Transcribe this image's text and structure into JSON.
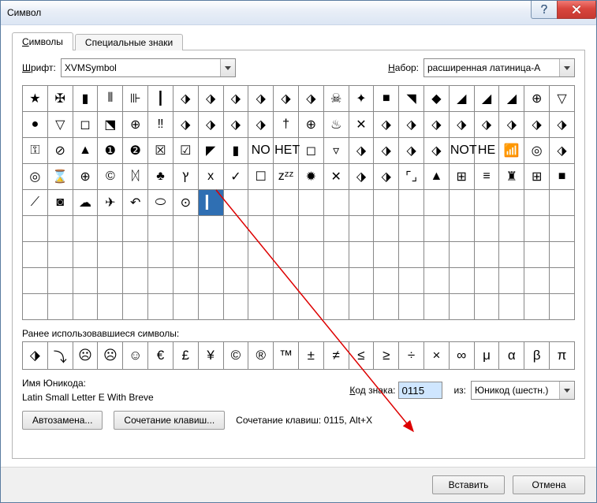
{
  "window": {
    "title": "Символ"
  },
  "tabs": {
    "symbols": "Символы",
    "special": "Специальные знаки"
  },
  "font_row": {
    "label": "Шрифт:",
    "value": "XVMSymbol",
    "set_label": "Набор:",
    "set_value": "расширенная латиница-A"
  },
  "grid": {
    "cols": 22,
    "rows": 9,
    "items": [
      "★",
      "✠",
      "▮",
      "⦀",
      "⊪",
      "┃",
      "⬗",
      "⬗",
      "⬗",
      "⬗",
      "⬗",
      "⬗",
      "☠",
      "✦",
      "■",
      "◥",
      "◆",
      "◢",
      "◢",
      "◢",
      "⊕",
      "▽",
      "●",
      "▽",
      "◻",
      "⬔",
      "⊕",
      "‼",
      "⬗",
      "⬗",
      "⬗",
      "⬗",
      "†",
      "⊕",
      "♨",
      "✕",
      "⬗",
      "⬗",
      "⬗",
      "⬗",
      "⬗",
      "⬗",
      "⬗",
      "⬗",
      "⚿",
      "⊘",
      "▲",
      "❶",
      "❷",
      "☒",
      "☑",
      "◤",
      "▮",
      "NO",
      "HET",
      "◻",
      "▿",
      "⬗",
      "⬗",
      "⬗",
      "⬗",
      "NOT",
      "HE",
      "📶",
      "◎",
      "⬗",
      "◎",
      "⌛",
      "⊕",
      "©",
      "ᛞ",
      "♣",
      "ץ",
      "x",
      "✓",
      "☐",
      "zᶻᶻ",
      "✹",
      "✕",
      "⬗",
      "⬗",
      "⌜⌟",
      "▲",
      "⊞",
      "≡",
      "♜",
      "⊞",
      "■",
      "⟋",
      "◙",
      "☁",
      "✈",
      "↶",
      "⬭",
      "⊙",
      "▎"
    ],
    "selected_index": 95
  },
  "recent": {
    "label": "Ранее использовавшиеся символы:",
    "items": [
      "⬗",
      "⤵",
      "☹",
      "☹",
      "☺",
      "€",
      "£",
      "¥",
      "©",
      "®",
      "™",
      "±",
      "≠",
      "≤",
      "≥",
      "÷",
      "×",
      "∞",
      "μ",
      "α",
      "β",
      "π"
    ]
  },
  "unicode": {
    "label": "Имя Юникода:",
    "name": "Latin Small Letter E With Breve",
    "code_label": "Код знака:",
    "code_value": "0115",
    "from_label": "из:",
    "from_value": "Юникод (шестн.)"
  },
  "buttons": {
    "autoreplace": "Автозамена...",
    "shortcut": "Сочетание клавиш...",
    "shortcut_text": "Сочетание клавиш: 0115, Alt+X",
    "insert": "Вставить",
    "cancel": "Отмена"
  }
}
